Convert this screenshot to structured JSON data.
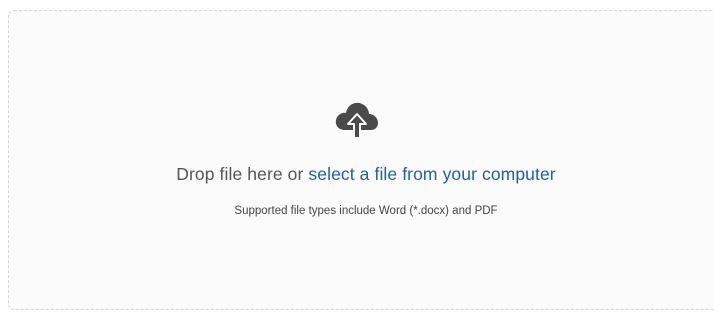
{
  "upload": {
    "icon": "cloud-upload-icon",
    "prompt_text": "Drop file here or",
    "link_text": "select a file from your computer",
    "supported_text": "Supported file types include Word (*.docx) and PDF"
  },
  "colors": {
    "link": "#1a5fb4",
    "icon": "#4a4a4a",
    "text": "#555555",
    "border": "#d6d6d6"
  }
}
